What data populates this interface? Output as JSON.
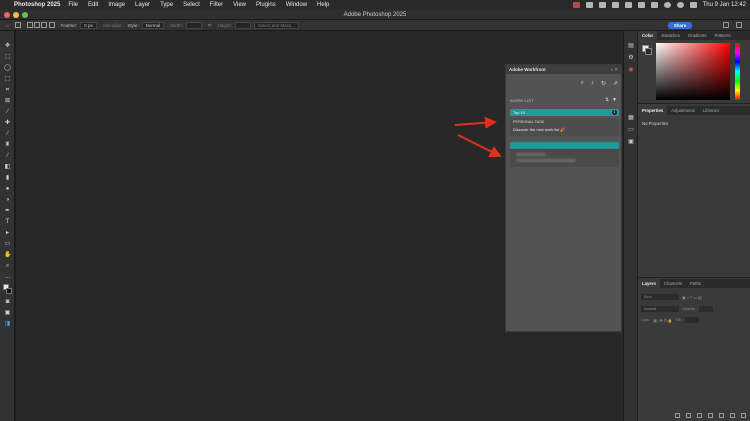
{
  "menubar": {
    "apple": "",
    "app_name": "Photoshop 2025",
    "items": [
      "File",
      "Edit",
      "Image",
      "Layer",
      "Type",
      "Select",
      "Filter",
      "View",
      "Plugins",
      "Window",
      "Help"
    ],
    "clock": "Thu 9 Jan  12:42"
  },
  "window": {
    "title": "Adobe Photoshop 2025"
  },
  "options": {
    "feather_label": "Feather:",
    "feather_value": "0 px",
    "antialias": "Anti-alias",
    "style_label": "Style:",
    "style_value": "Normal",
    "width_label": "Width:",
    "height_label": "Height:",
    "select_mask": "Select and Mask...",
    "share": "Share"
  },
  "workfront": {
    "title": "Adobe Workfront",
    "work_list_label": "WORK LIST",
    "group_bar": "Top 10",
    "badge": "1",
    "task_project": "PERSONAL TASK",
    "task_title": "Discover the new work list 🎉"
  },
  "dock": {
    "color_tabs": [
      "Color",
      "Swatches",
      "Gradients",
      "Patterns"
    ],
    "props_tabs": [
      "Properties",
      "Adjustments",
      "Libraries"
    ],
    "no_properties": "No Properties",
    "layer_tabs": [
      "Layers",
      "Channels",
      "Paths"
    ],
    "kind": "Kind",
    "blend": "Normal",
    "opacity_label": "Opacity:",
    "lock_label": "Lock:",
    "fill_label": "Fill:"
  },
  "colors": {
    "accent_teal": "#1e9c9c",
    "share_blue": "#2f6fe0",
    "arrow_red": "#e0301e"
  }
}
